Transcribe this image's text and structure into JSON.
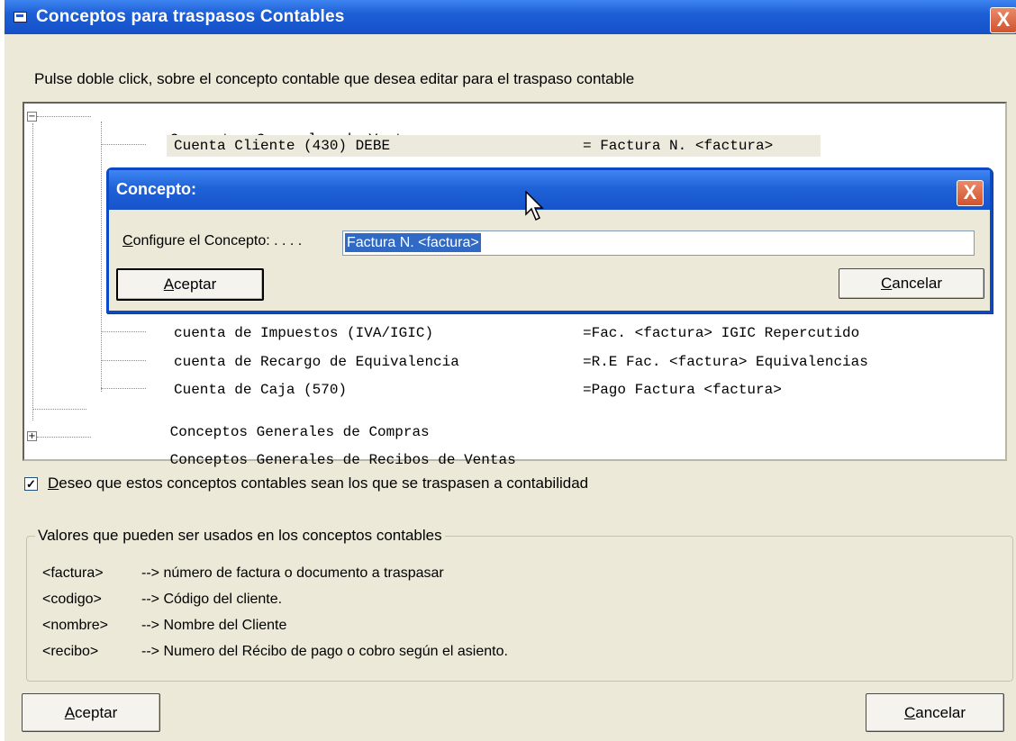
{
  "window": {
    "title": "Conceptos para traspasos Contables",
    "close_label": "X"
  },
  "instructions": "Pulse doble click, sobre el concepto contable que desea editar para el traspaso contable",
  "tree": {
    "groups": [
      {
        "label": "Conceptos Generales de Ventas",
        "expanded": true
      },
      {
        "label": "Conceptos Generales de Compras",
        "expanded": false
      },
      {
        "label": "Conceptos Generales de Recibos de Ventas",
        "expanded": false
      }
    ],
    "items": [
      {
        "label": "Cuenta Cliente (430) DEBE",
        "value": "= Factura N. <factura>",
        "selected": true
      },
      {
        "label": "cuenta de Impuestos (IVA/IGIC)",
        "value": "=Fac. <factura> IGIC Repercutido"
      },
      {
        "label": "cuenta de Recargo de Equivalencia",
        "value": "=R.E Fac. <factura> Equivalencias"
      },
      {
        "label": "Cuenta de Caja (570)",
        "value": "=Pago Factura <factura>"
      }
    ]
  },
  "checkbox": {
    "checked": true,
    "mark": "✓",
    "label_first": "D",
    "label_rest": "eseo que estos conceptos contables sean los que se traspasen a contabilidad"
  },
  "legend": {
    "title": "Valores que pueden ser usados en los conceptos contables",
    "rows": [
      {
        "code": "<factura>",
        "desc": "--> número de factura o documento a traspasar"
      },
      {
        "code": "<codigo>",
        "desc": "--> Código del cliente."
      },
      {
        "code": "<nombre>",
        "desc": "--> Nombre del Cliente"
      },
      {
        "code": "<recibo>",
        "desc": "--> Numero del Récibo de pago o cobro según el asiento."
      }
    ]
  },
  "buttons": {
    "ok_first": "A",
    "ok_rest": "ceptar",
    "cancel_first": "C",
    "cancel_rest": "ancelar"
  },
  "dialog": {
    "title": "Concepto:",
    "close_label": "X",
    "label_first": "C",
    "label_rest": "onfigure el Concepto: . . . .",
    "input_value": "Factura N. <factura>",
    "ok_first": "A",
    "ok_rest": "ceptar",
    "cancel_first": "C",
    "cancel_rest": "ancelar"
  },
  "colors": {
    "titlebar": "#1d5fd6",
    "window_bg": "#ece9d8",
    "selection": "#316ac5",
    "close": "#d2532c"
  }
}
